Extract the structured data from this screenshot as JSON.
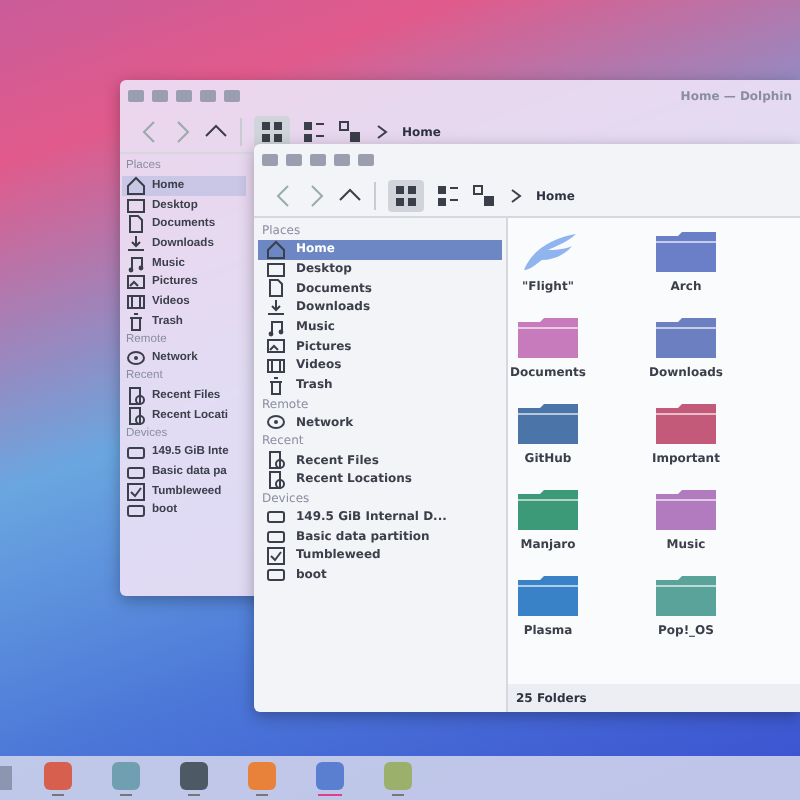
{
  "back_window": {
    "title": "Home — Dolphin",
    "breadcrumb": "Home",
    "sidebar": [
      {
        "heading": "Places",
        "items": [
          {
            "label": "Home",
            "kind": "home",
            "selected": true
          },
          {
            "label": "Desktop",
            "kind": "desktop",
            "selected": false
          },
          {
            "label": "Documents",
            "kind": "folder",
            "selected": false
          },
          {
            "label": "Downloads",
            "kind": "download",
            "selected": false
          },
          {
            "label": "Music",
            "kind": "music",
            "selected": false
          },
          {
            "label": "Pictures",
            "kind": "picture",
            "selected": false
          },
          {
            "label": "Videos",
            "kind": "video",
            "selected": false
          },
          {
            "label": "Trash",
            "kind": "trash",
            "selected": false
          }
        ]
      },
      {
        "heading": "Remote",
        "items": [
          {
            "label": "Network",
            "kind": "network",
            "selected": false
          }
        ]
      },
      {
        "heading": "Recent",
        "items": [
          {
            "label": "Recent Files",
            "kind": "recent",
            "selected": false
          },
          {
            "label": "Recent Locati",
            "kind": "recent",
            "selected": false
          }
        ]
      },
      {
        "heading": "Devices",
        "items": [
          {
            "label": "149.5 GiB Inte",
            "kind": "drive",
            "selected": false
          },
          {
            "label": "Basic data pa",
            "kind": "drive",
            "selected": false
          },
          {
            "label": "Tumbleweed",
            "kind": "check",
            "selected": false
          },
          {
            "label": "boot",
            "kind": "drive",
            "selected": false
          }
        ]
      }
    ]
  },
  "front_window": {
    "breadcrumb": "Home",
    "sidebar": [
      {
        "heading": "Places",
        "items": [
          {
            "label": "Home",
            "kind": "home",
            "selected": true
          },
          {
            "label": "Desktop",
            "kind": "desktop",
            "selected": false
          },
          {
            "label": "Documents",
            "kind": "folder",
            "selected": false
          },
          {
            "label": "Downloads",
            "kind": "download",
            "selected": false
          },
          {
            "label": "Music",
            "kind": "music",
            "selected": false
          },
          {
            "label": "Pictures",
            "kind": "picture",
            "selected": false
          },
          {
            "label": "Videos",
            "kind": "video",
            "selected": false
          },
          {
            "label": "Trash",
            "kind": "trash",
            "selected": false
          }
        ]
      },
      {
        "heading": "Remote",
        "items": [
          {
            "label": "Network",
            "kind": "network",
            "selected": false
          }
        ]
      },
      {
        "heading": "Recent",
        "items": [
          {
            "label": "Recent Files",
            "kind": "recent",
            "selected": false
          },
          {
            "label": "Recent Locations",
            "kind": "recent",
            "selected": false
          }
        ]
      },
      {
        "heading": "Devices",
        "items": [
          {
            "label": "149.5 GiB Internal D...",
            "kind": "drive",
            "selected": false
          },
          {
            "label": "Basic data partition",
            "kind": "drive",
            "selected": false
          },
          {
            "label": "Tumbleweed",
            "kind": "check",
            "selected": false
          },
          {
            "label": "boot",
            "kind": "drive",
            "selected": false
          }
        ]
      }
    ],
    "files": [
      {
        "name": "\"Flight\"",
        "kind": "app",
        "color": "#8fb4ee"
      },
      {
        "name": "Arch",
        "kind": "folder",
        "color": "#6a7fc8"
      },
      {
        "name": "Documents",
        "kind": "folder",
        "color": "#c77bbd"
      },
      {
        "name": "Downloads",
        "kind": "folder",
        "color": "#6c7fc0"
      },
      {
        "name": "GitHub",
        "kind": "folder",
        "color": "#4b74a8"
      },
      {
        "name": "Important",
        "kind": "folder",
        "color": "#c45a7a"
      },
      {
        "name": "Manjaro",
        "kind": "folder",
        "color": "#3d9a78"
      },
      {
        "name": "Music",
        "kind": "folder",
        "color": "#b27bc0"
      },
      {
        "name": "Plasma",
        "kind": "folder",
        "color": "#3a82c8"
      },
      {
        "name": "Pop!_OS",
        "kind": "folder",
        "color": "#5aa39a"
      }
    ],
    "status_bar": "25 Folders"
  },
  "taskbar": {
    "apps": [
      {
        "color": "#d65f4e",
        "selected": false
      },
      {
        "color": "#6f9fb0",
        "selected": false
      },
      {
        "color": "#4d5a66",
        "selected": false
      },
      {
        "color": "#e8823a",
        "selected": false
      },
      {
        "color": "#5b7fd0",
        "selected": true
      },
      {
        "color": "#9bb06a",
        "selected": false
      }
    ]
  }
}
